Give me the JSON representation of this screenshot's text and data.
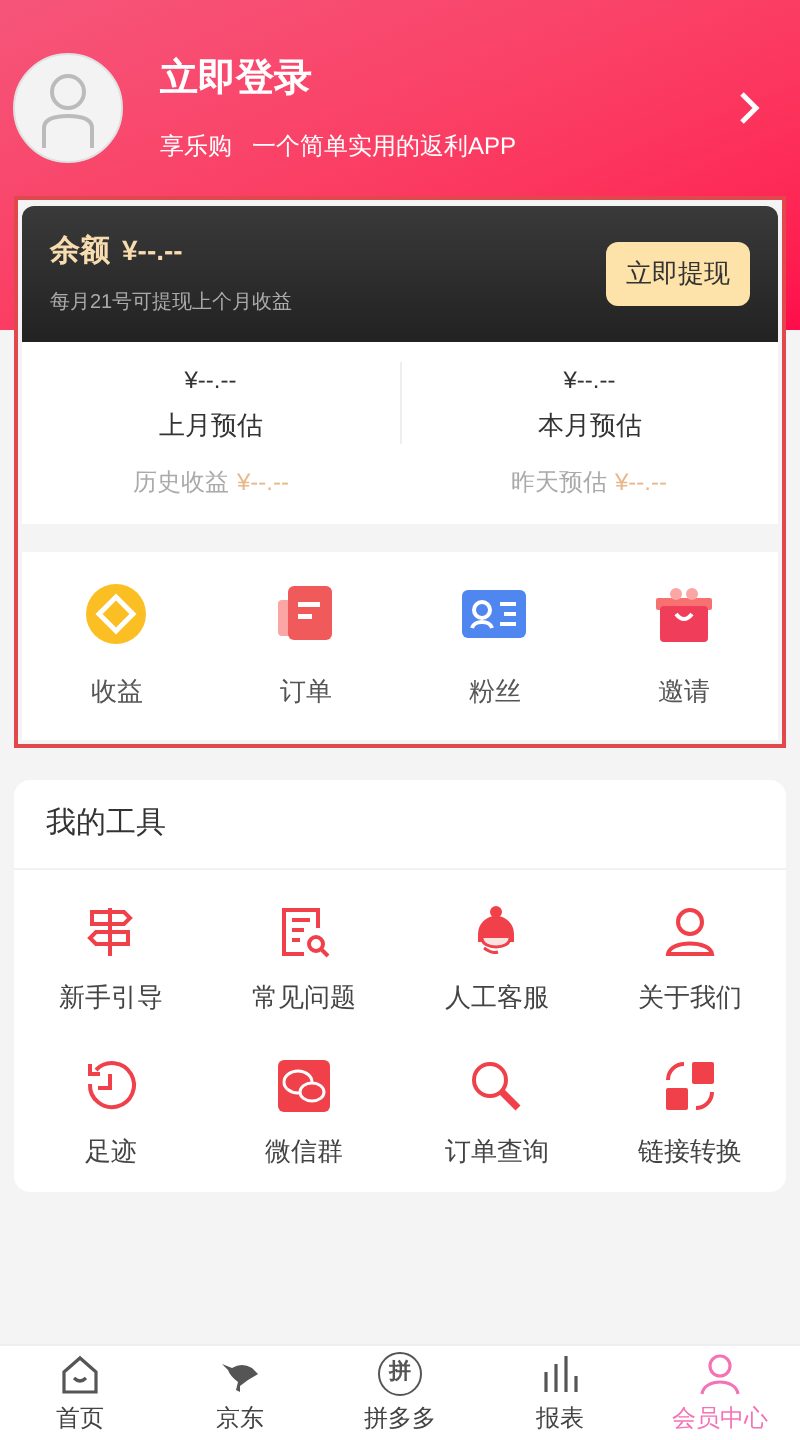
{
  "profile": {
    "title": "立即登录",
    "subtitle": "享乐购   一个简单实用的返利APP"
  },
  "balance": {
    "label": "余额",
    "amount": "¥--.--",
    "note": "每月21号可提现上个月收益",
    "button": "立即提现"
  },
  "estimates": [
    {
      "amount": "¥--.--",
      "label": "上月预估"
    },
    {
      "amount": "¥--.--",
      "label": "本月预估"
    }
  ],
  "history": [
    {
      "label": "历史收益",
      "amount": "¥--.--"
    },
    {
      "label": "昨天预估",
      "amount": "¥--.--"
    }
  ],
  "shortcuts": [
    {
      "kind": "coin",
      "label": "收益"
    },
    {
      "kind": "order",
      "label": "订单"
    },
    {
      "kind": "fans",
      "label": "粉丝"
    },
    {
      "kind": "gift",
      "label": "邀请"
    }
  ],
  "tools": {
    "title": "我的工具",
    "items": [
      {
        "kind": "signpost",
        "label": "新手引导"
      },
      {
        "kind": "doc",
        "label": "常见问题"
      },
      {
        "kind": "agent",
        "label": "人工客服"
      },
      {
        "kind": "person",
        "label": "关于我们"
      },
      {
        "kind": "history",
        "label": "足迹"
      },
      {
        "kind": "chat",
        "label": "微信群"
      },
      {
        "kind": "search",
        "label": "订单查询"
      },
      {
        "kind": "convert",
        "label": "链接转换"
      }
    ]
  },
  "tab_bar": [
    {
      "kind": "home",
      "label": "首页",
      "selected": false
    },
    {
      "kind": "bird",
      "label": "京东",
      "selected": false
    },
    {
      "kind": "pin",
      "glyph": "拼",
      "label": "拼多多",
      "selected": false
    },
    {
      "kind": "chart",
      "label": "报表",
      "selected": false
    },
    {
      "kind": "person",
      "label": "会员中心",
      "selected": true
    }
  ]
}
